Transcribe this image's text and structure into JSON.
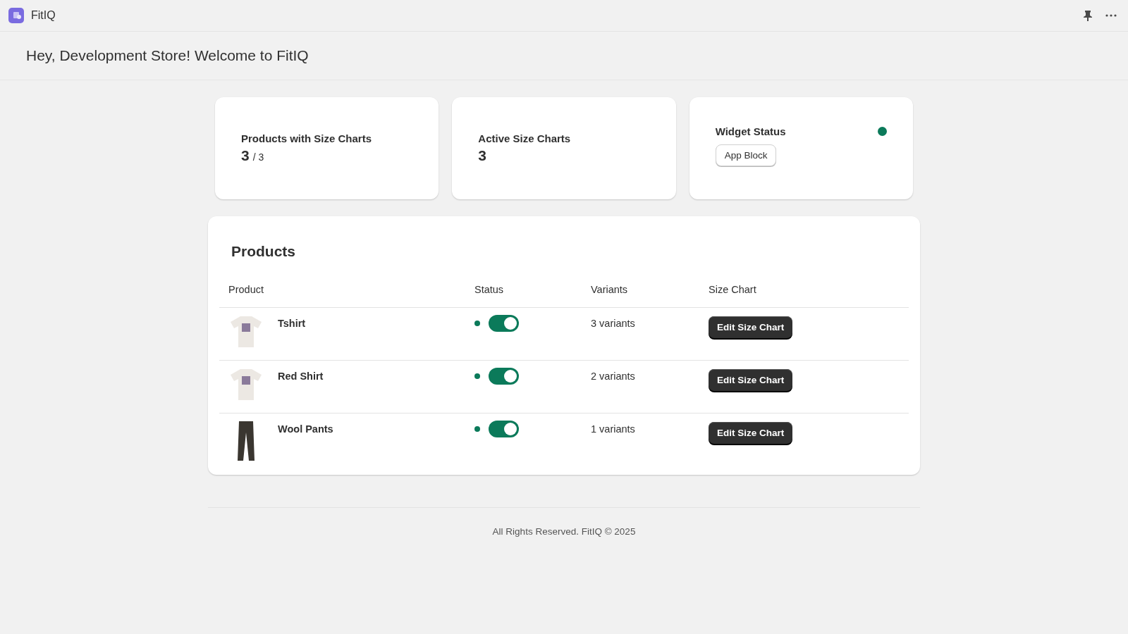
{
  "app_bar": {
    "title": "FitIQ"
  },
  "header": {
    "title": "Hey, Development Store! Welcome to FitIQ"
  },
  "stats": [
    {
      "kind": "ratio",
      "label": "Products with Size Charts",
      "value": "3",
      "total": "/ 3"
    },
    {
      "kind": "count",
      "label": "Active Size Charts",
      "value": "3"
    },
    {
      "kind": "widget",
      "label": "Widget Status",
      "active": true,
      "button": "App Block"
    }
  ],
  "products": {
    "title": "Products",
    "columns": [
      "Product",
      "Status",
      "Variants",
      "Size Chart"
    ],
    "rows": [
      {
        "kind": "shirt",
        "name": "Tshirt",
        "on": true,
        "variants": "3 variants",
        "action": "Edit Size Chart"
      },
      {
        "kind": "shirt",
        "name": "Red Shirt",
        "on": true,
        "variants": "2 variants",
        "action": "Edit Size Chart"
      },
      {
        "kind": "pants",
        "name": "Wool Pants",
        "on": true,
        "variants": "1 variants",
        "action": "Edit Size Chart"
      }
    ]
  },
  "footer": "All Rights Reserved. FitIQ © 2025"
}
